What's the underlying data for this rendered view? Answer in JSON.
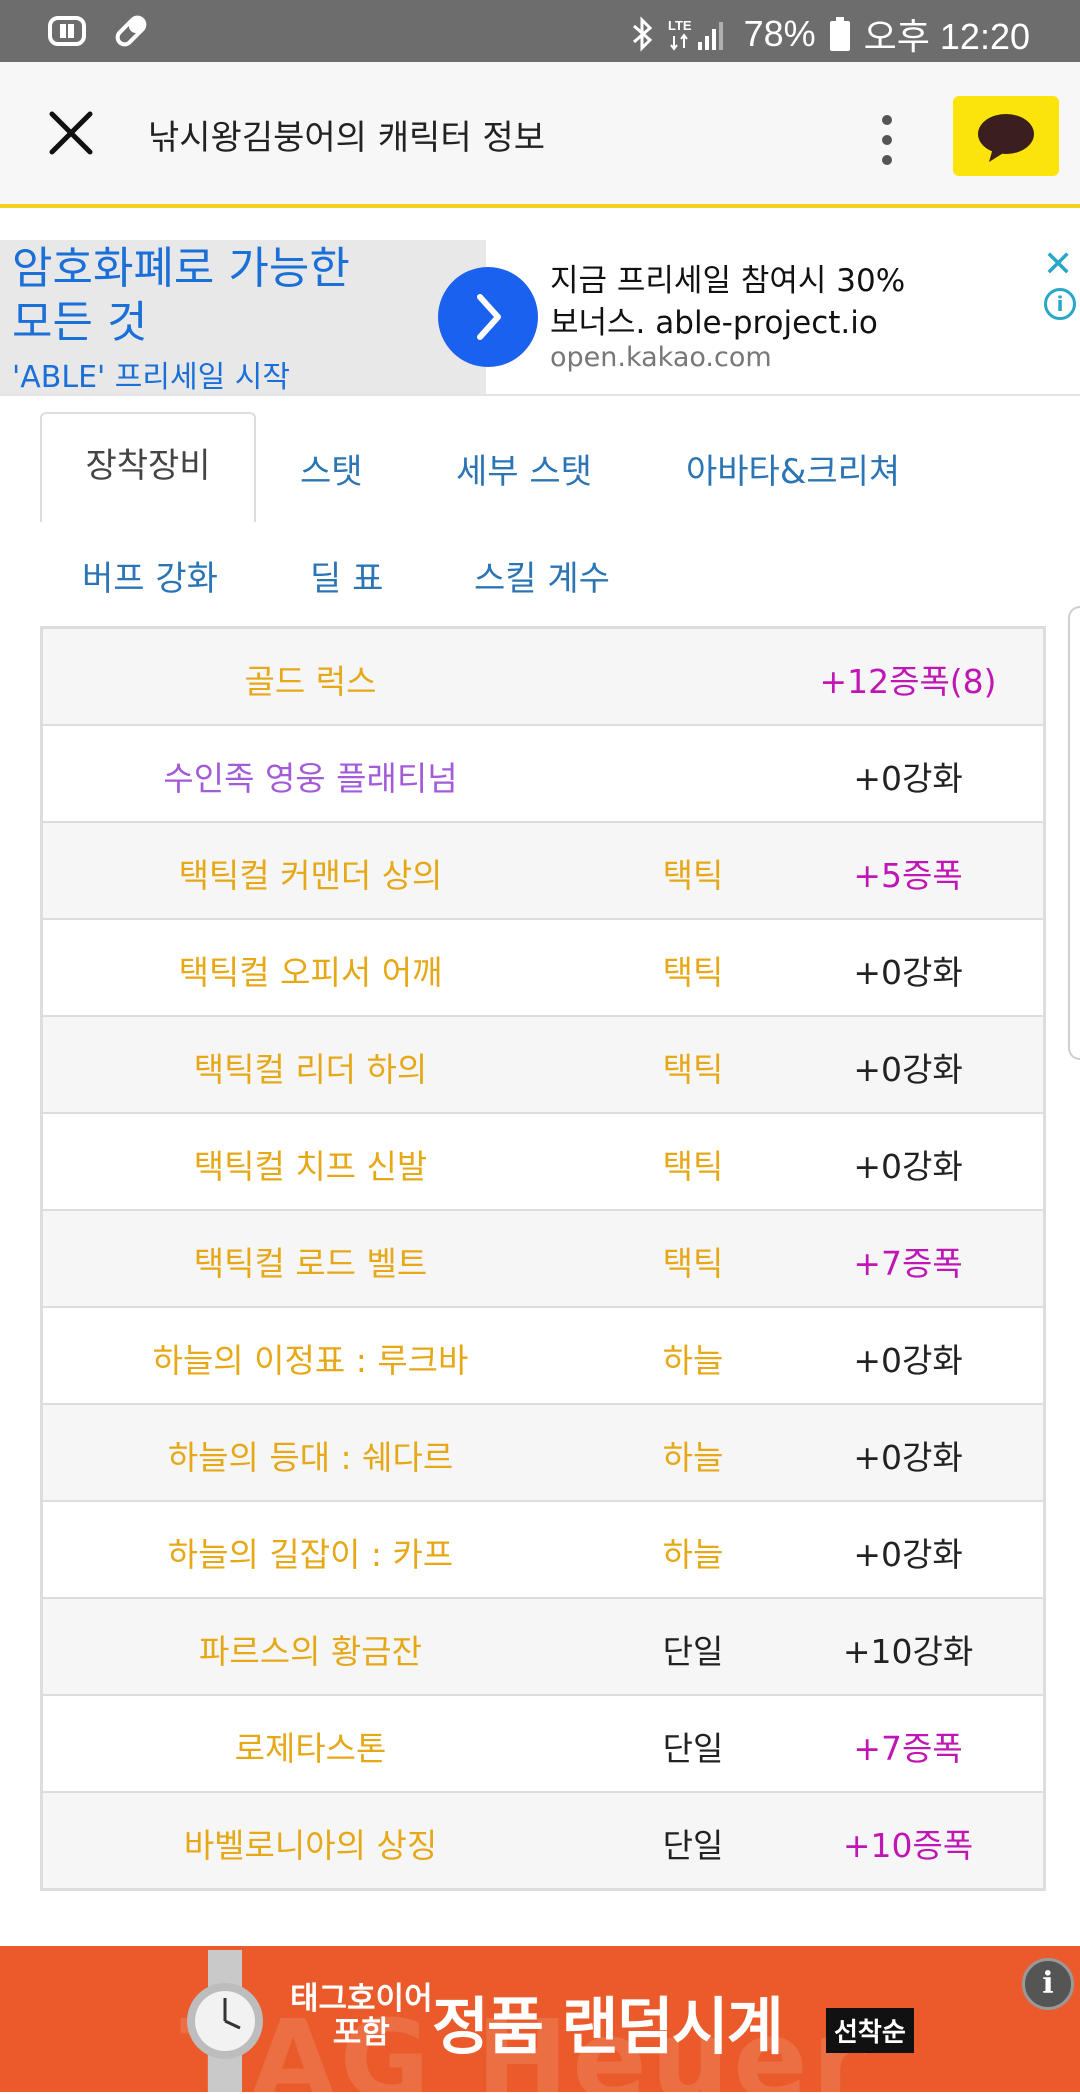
{
  "status_bar": {
    "battery": "78%",
    "time": "오후 12:20",
    "network": "LTE"
  },
  "header": {
    "title": "낚시왕김붕어의 캐릭터 정보"
  },
  "ad": {
    "headline": "암호화폐로 가능한\n모든 것",
    "subline": "'ABLE' 프리세일 시작",
    "body": "지금 프리세일 참여시 30%\n보너스. able-project.io",
    "domain": "open.kakao.com",
    "close": "✕",
    "info": "i"
  },
  "tabs": [
    {
      "label": "장착장비",
      "active": true
    },
    {
      "label": "스탯"
    },
    {
      "label": "세부 스탯"
    },
    {
      "label": "아바타&크리쳐"
    },
    {
      "label": "버프 강화"
    },
    {
      "label": "딜 표"
    },
    {
      "label": "스킬 계수"
    }
  ],
  "equipment": [
    {
      "name": "골드 럭스",
      "set": "",
      "enh": "+12증폭(8)"
    },
    {
      "name": "수인족 영웅 플래티넘",
      "set": "",
      "enh": "+0강화"
    },
    {
      "name": "택틱컬 커맨더 상의",
      "set": "택틱",
      "enh": "+5증폭"
    },
    {
      "name": "택틱컬 오피서 어깨",
      "set": "택틱",
      "enh": "+0강화"
    },
    {
      "name": "택틱컬 리더 하의",
      "set": "택틱",
      "enh": "+0강화"
    },
    {
      "name": "택틱컬 치프 신발",
      "set": "택틱",
      "enh": "+0강화"
    },
    {
      "name": "택틱컬 로드 벨트",
      "set": "택틱",
      "enh": "+7증폭"
    },
    {
      "name": "하늘의 이정표 : 루크바",
      "set": "하늘",
      "enh": "+0강화"
    },
    {
      "name": "하늘의 등대 : 쉐다르",
      "set": "하늘",
      "enh": "+0강화"
    },
    {
      "name": "하늘의 길잡이 : 카프",
      "set": "하늘",
      "enh": "+0강화"
    },
    {
      "name": "파르스의 황금잔",
      "set": "단일",
      "enh": "+10강화"
    },
    {
      "name": "로제타스톤",
      "set": "단일",
      "enh": "+7증폭"
    },
    {
      "name": "바벨로니아의 상징",
      "set": "단일",
      "enh": "+10증폭"
    }
  ],
  "bottom_ad": {
    "tag_line1": "태그호이어",
    "tag_line2": "포함",
    "main": "정품 랜덤시계",
    "badge": "선착순",
    "bg_text": "TAG Heuer",
    "info": "i"
  },
  "colors": {
    "gold_item": "#e6a817",
    "purple_item": "#a35bd8",
    "amplified": "#c016b6",
    "tab_link": "#2b75b5",
    "kakao_yellow": "#fbe40a",
    "ad_orange": "#ea5a2a"
  }
}
